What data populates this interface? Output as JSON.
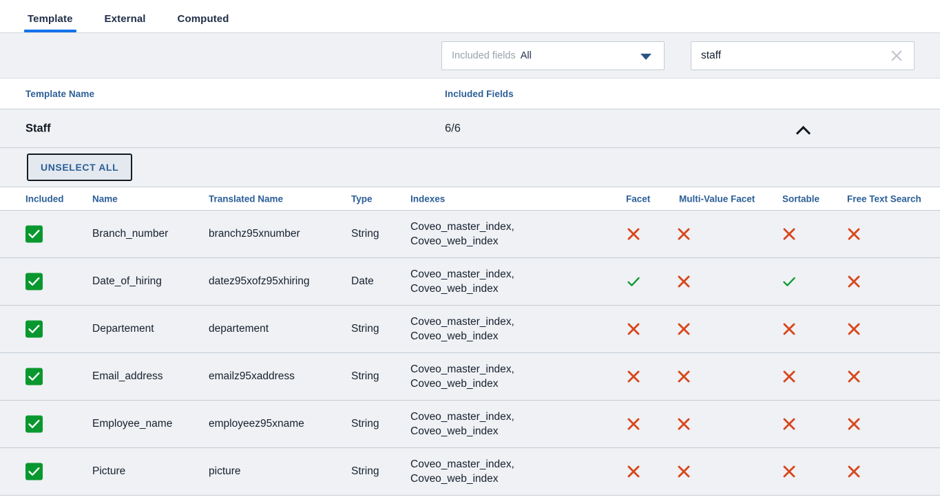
{
  "tabs": [
    {
      "label": "Template",
      "active": true
    },
    {
      "label": "External",
      "active": false
    },
    {
      "label": "Computed",
      "active": false
    }
  ],
  "filter": {
    "dropdown_label": "Included fields",
    "dropdown_value": "All",
    "caret_icon": "chevron-down-icon",
    "search_value": "staff",
    "search_placeholder": "",
    "clear_icon": "close-icon"
  },
  "templates_table": {
    "headers": {
      "name": "Template Name",
      "included_fields": "Included Fields"
    },
    "row": {
      "name": "Staff",
      "included_fields": "6/6",
      "collapse_icon": "chevron-up-icon"
    }
  },
  "actions": {
    "unselect_all": "UNSELECT ALL"
  },
  "fields_table": {
    "headers": [
      "Included",
      "Name",
      "Translated Name",
      "Type",
      "Indexes",
      "Facet",
      "Multi-Value Facet",
      "Sortable",
      "Free Text Search"
    ],
    "rows": [
      {
        "included": true,
        "name": "Branch_number",
        "translated_name": "branchz95xnumber",
        "type": "String",
        "indexes": "Coveo_master_index,\nCoveo_web_index",
        "facet": false,
        "multi_value_facet": false,
        "sortable": false,
        "free_text_search": false
      },
      {
        "included": true,
        "name": "Date_of_hiring",
        "translated_name": "datez95xofz95xhiring",
        "type": "Date",
        "indexes": "Coveo_master_index,\nCoveo_web_index",
        "facet": true,
        "multi_value_facet": false,
        "sortable": true,
        "free_text_search": false
      },
      {
        "included": true,
        "name": "Departement",
        "translated_name": "departement",
        "type": "String",
        "indexes": "Coveo_master_index,\nCoveo_web_index",
        "facet": false,
        "multi_value_facet": false,
        "sortable": false,
        "free_text_search": false
      },
      {
        "included": true,
        "name": "Email_address",
        "translated_name": "emailz95xaddress",
        "type": "String",
        "indexes": "Coveo_master_index,\nCoveo_web_index",
        "facet": false,
        "multi_value_facet": false,
        "sortable": false,
        "free_text_search": false
      },
      {
        "included": true,
        "name": "Employee_name",
        "translated_name": "employeez95xname",
        "type": "String",
        "indexes": "Coveo_master_index,\nCoveo_web_index",
        "facet": false,
        "multi_value_facet": false,
        "sortable": false,
        "free_text_search": false
      },
      {
        "included": true,
        "name": "Picture",
        "translated_name": "picture",
        "type": "String",
        "indexes": "Coveo_master_index,\nCoveo_web_index",
        "facet": false,
        "multi_value_facet": false,
        "sortable": false,
        "free_text_search": false
      }
    ]
  },
  "colors": {
    "accent_blue": "#1372ec",
    "header_blue": "#2b5e97",
    "check_green": "#09982f",
    "cross_red": "#d8471c",
    "row_bg": "#eff1f4"
  }
}
